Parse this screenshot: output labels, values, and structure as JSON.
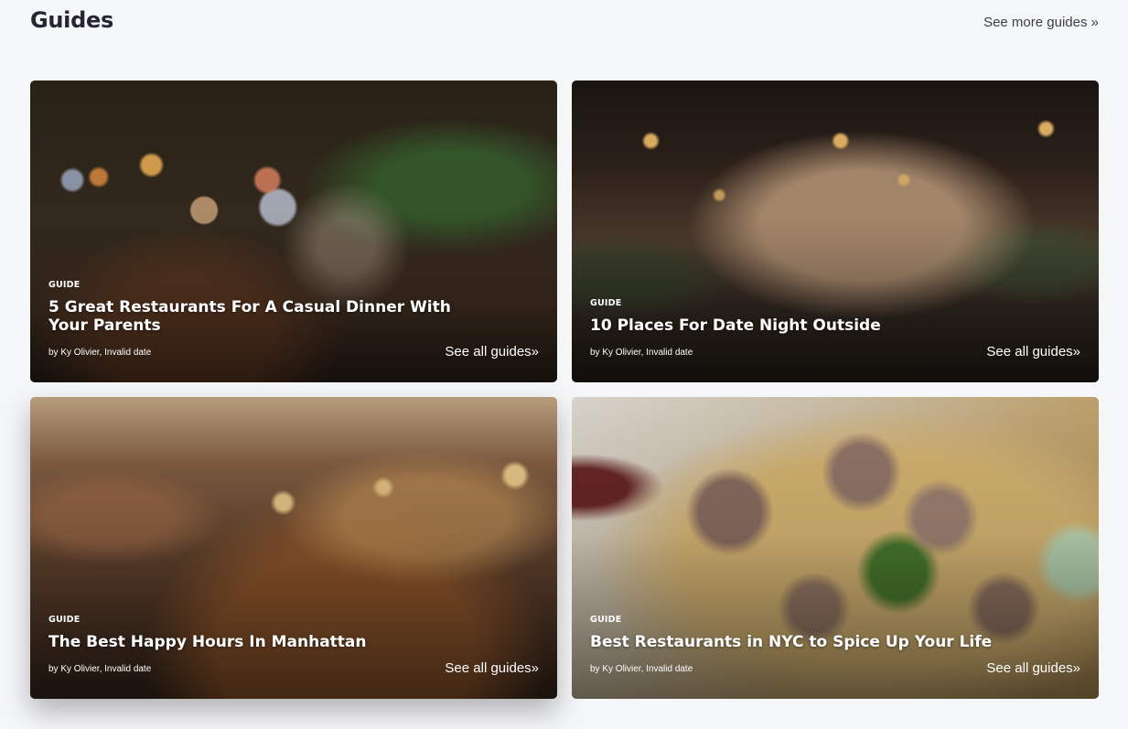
{
  "header": {
    "title": "Guides",
    "see_more_label": "See more guides »"
  },
  "cards": [
    {
      "tag": "GUIDE",
      "title": "5 Great Restaurants For A Casual Dinner With Your Parents",
      "byline": "by Ky Olivier, Invalid date",
      "link_label": "See all guides»",
      "image": "restaurant-patio-with-lanterns"
    },
    {
      "tag": "GUIDE",
      "title": "10 Places For Date Night Outside",
      "byline": "by Ky Olivier, Invalid date",
      "link_label": "See all guides»",
      "image": "outdoor-garden-at-night"
    },
    {
      "tag": "GUIDE",
      "title": "The Best Happy Hours In Manhattan",
      "byline": "by Ky Olivier, Invalid date",
      "link_label": "See all guides»",
      "image": "bar-interior-with-lights"
    },
    {
      "tag": "GUIDE",
      "title": "Best Restaurants in NYC to Spice Up Your Life",
      "byline": "by Ky Olivier, Invalid date",
      "link_label": "See all guides»",
      "image": "noodle-bowl-with-beef"
    }
  ]
}
